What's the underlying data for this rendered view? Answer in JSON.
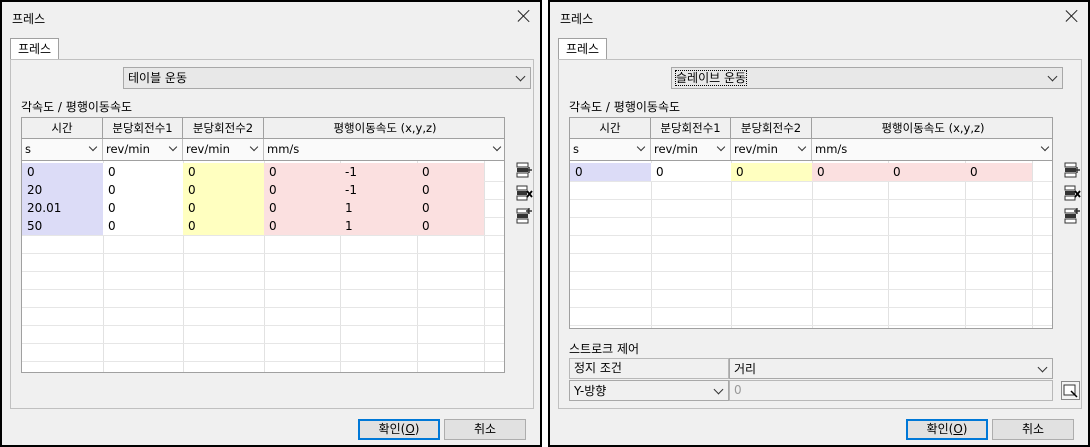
{
  "left_dialog": {
    "title": "프레스",
    "tab": "프레스",
    "motion_select": "테이블 운동",
    "group_label": "각속도 / 평행이동속도",
    "columns": [
      "시간",
      "분당회전수1",
      "분당회전수2",
      "평행이동속도 (x,y,z)"
    ],
    "units": [
      "s",
      "rev/min",
      "rev/min",
      "mm/s"
    ],
    "rows": [
      [
        "0",
        "0",
        "0",
        "0",
        "-1",
        "0"
      ],
      [
        "20",
        "0",
        "0",
        "0",
        "-1",
        "0"
      ],
      [
        "20.01",
        "0",
        "0",
        "0",
        "1",
        "0"
      ],
      [
        "50",
        "0",
        "0",
        "0",
        "1",
        "0"
      ]
    ],
    "ok_label": "확인(",
    "ok_key": "O",
    "ok_end": ")",
    "cancel_label": "취소"
  },
  "right_dialog": {
    "title": "프레스",
    "tab": "프레스",
    "motion_select": "슬레이브 운동",
    "group_label": "각속도 / 평행이동속도",
    "columns": [
      "시간",
      "분당회전수1",
      "분당회전수2",
      "평행이동속도 (x,y,z)"
    ],
    "units": [
      "s",
      "rev/min",
      "rev/min",
      "mm/s"
    ],
    "rows": [
      [
        "0",
        "0",
        "0",
        "0",
        "0",
        "0"
      ]
    ],
    "stroke_group": "스트로크 제어",
    "stop_condition_label": "정지 조건",
    "stop_condition_value": "거리",
    "direction_value": "Y-방향",
    "direction_input": "0",
    "ok_label": "확인(",
    "ok_key": "O",
    "ok_end": ")",
    "cancel_label": "취소"
  },
  "colors": {
    "time_col": "#dcdcf7",
    "rpm2_col": "#ffffc0",
    "vel_col": "#fbe0e0",
    "focus_border": "#0078d7"
  }
}
